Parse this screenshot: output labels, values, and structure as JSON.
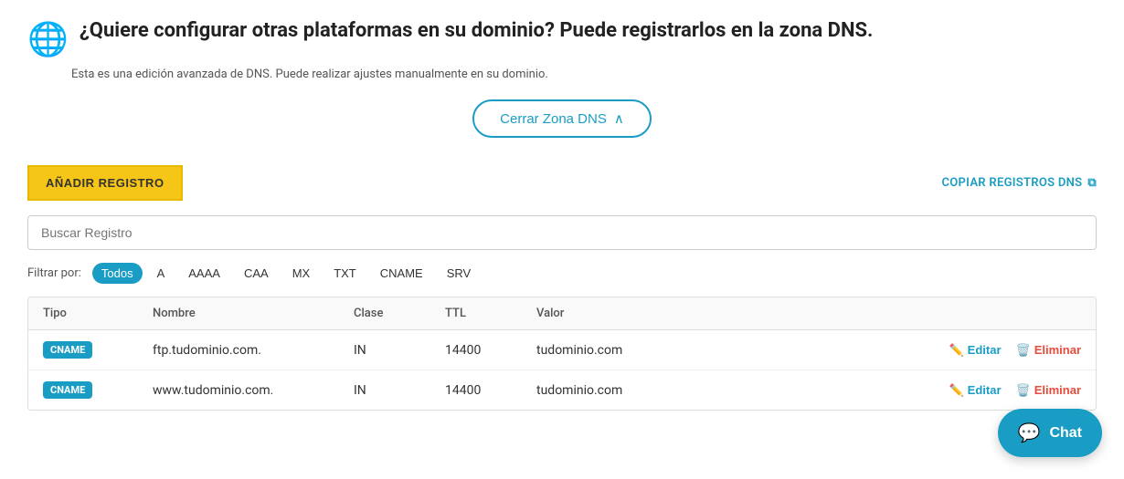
{
  "header": {
    "globe_icon": "🌐",
    "title": "¿Quiere configurar otras plataformas en su dominio? Puede registrarlos en la zona DNS.",
    "subtitle": "Esta es una edición avanzada de DNS. Puede realizar ajustes manualmente en su dominio."
  },
  "cerrar_btn": {
    "label": "Cerrar Zona DNS",
    "chevron": "∧"
  },
  "toolbar": {
    "add_btn_label": "AÑADIR REGISTRO",
    "copy_btn_label": "COPIAR REGISTROS DNS",
    "copy_icon": "⧉"
  },
  "search": {
    "placeholder": "Buscar Registro"
  },
  "filters": {
    "label": "Filtrar por:",
    "options": [
      {
        "id": "todos",
        "label": "Todos",
        "active": true
      },
      {
        "id": "a",
        "label": "A",
        "active": false
      },
      {
        "id": "aaaa",
        "label": "AAAA",
        "active": false
      },
      {
        "id": "caa",
        "label": "CAA",
        "active": false
      },
      {
        "id": "mx",
        "label": "MX",
        "active": false
      },
      {
        "id": "txt",
        "label": "TXT",
        "active": false
      },
      {
        "id": "cname",
        "label": "CNAME",
        "active": false
      },
      {
        "id": "srv",
        "label": "SRV",
        "active": false
      }
    ]
  },
  "table": {
    "headers": [
      "Tipo",
      "Nombre",
      "Clase",
      "TTL",
      "Valor",
      ""
    ],
    "rows": [
      {
        "tipo": "CNAME",
        "nombre": "ftp.tudominio.com.",
        "clase": "IN",
        "ttl": "14400",
        "valor": "tudominio.com",
        "edit_label": "Editar",
        "delete_label": "Eliminar"
      },
      {
        "tipo": "CNAME",
        "nombre": "www.tudominio.com.",
        "clase": "IN",
        "ttl": "14400",
        "valor": "tudominio.com",
        "edit_label": "Editar",
        "delete_label": "Eliminar"
      }
    ]
  },
  "chat": {
    "label": "Chat",
    "icon": "💬"
  }
}
